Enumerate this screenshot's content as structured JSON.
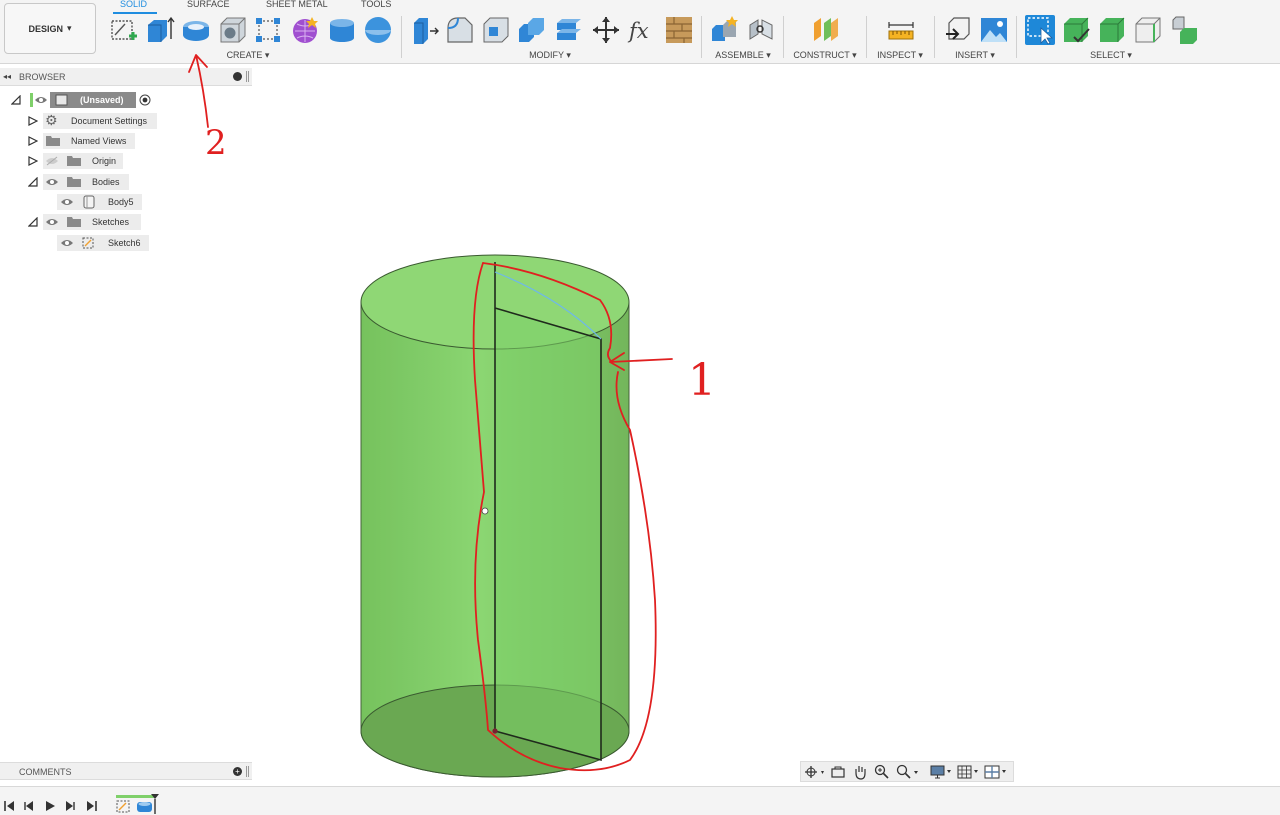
{
  "workspace": {
    "label": "DESIGN",
    "caret": "▾"
  },
  "tabs": [
    {
      "label": "SOLID",
      "active": true
    },
    {
      "label": "SURFACE",
      "active": false
    },
    {
      "label": "SHEET METAL",
      "active": false
    },
    {
      "label": "TOOLS",
      "active": false
    }
  ],
  "groups": {
    "create": "CREATE ▾",
    "modify": "MODIFY ▾",
    "assemble": "ASSEMBLE ▾",
    "construct": "CONSTRUCT ▾",
    "inspect": "INSPECT ▾",
    "insert": "INSERT ▾",
    "select": "SELECT ▾"
  },
  "tool_icons": {
    "create": [
      "create-sketch-icon",
      "extrude-icon",
      "revolve-icon",
      "hole-icon",
      "pattern-icon",
      "create-form-icon",
      "cylinder-icon",
      "sphere-icon"
    ],
    "modify": [
      "press-pull-icon",
      "fillet-icon",
      "shell-icon",
      "combine-icon",
      "split-body-icon",
      "move-icon",
      "parameters-icon",
      "appearance-icon"
    ],
    "assemble": [
      "new-component-icon",
      "joint-icon"
    ],
    "construct": [
      "offset-plane-icon"
    ],
    "inspect": [
      "measure-icon"
    ],
    "insert": [
      "insert-derive-icon",
      "insert-canvas-icon"
    ],
    "select": [
      "select-icon",
      "select-body-icon",
      "select-face-icon",
      "select-edge-icon",
      "select-component-icon"
    ]
  },
  "browser": {
    "title": "BROWSER",
    "root": "(Unsaved)",
    "items": [
      {
        "label": "Document Settings"
      },
      {
        "label": "Named Views"
      },
      {
        "label": "Origin"
      },
      {
        "label": "Bodies"
      },
      {
        "label": "Body5"
      },
      {
        "label": "Sketches"
      },
      {
        "label": "Sketch6"
      }
    ]
  },
  "comments": {
    "title": "COMMENTS"
  },
  "annotations": {
    "arrow_1": "1",
    "arrow_2": "2"
  },
  "colors": {
    "accent": "#1f8de0",
    "body_fill": "#7ed063",
    "annotation": "#e02020"
  }
}
